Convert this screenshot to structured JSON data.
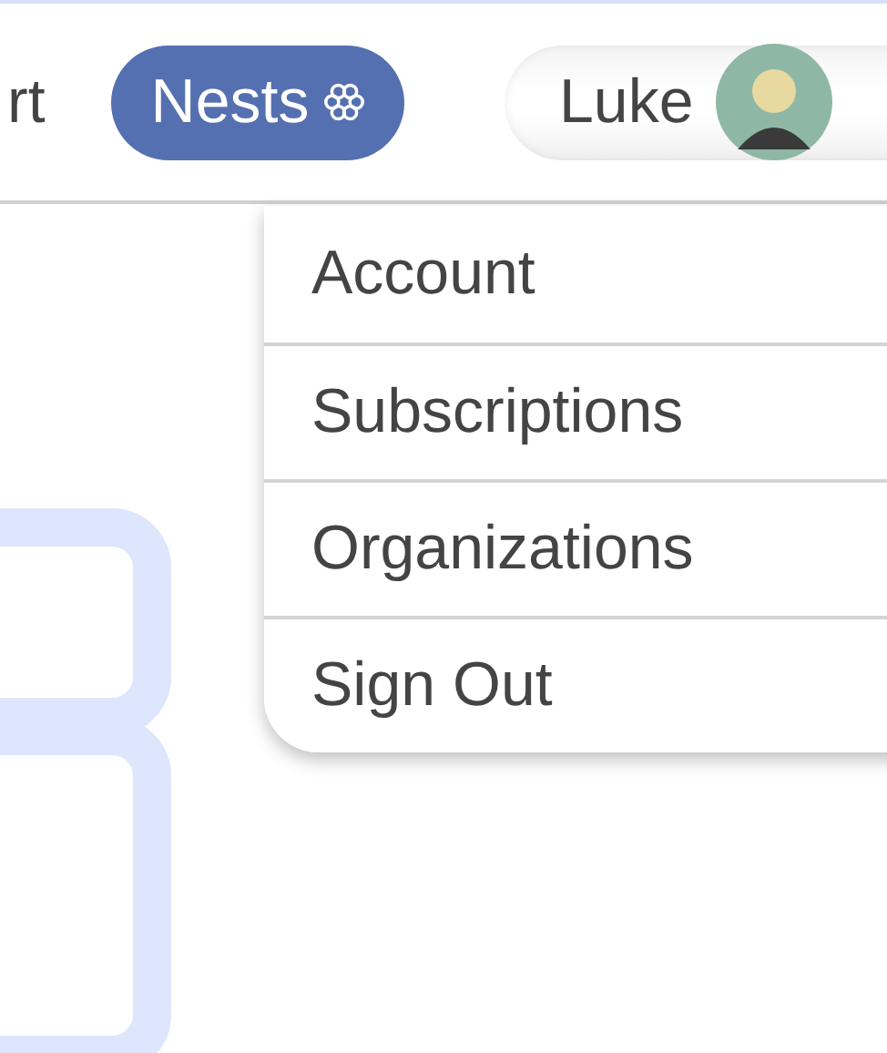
{
  "nav": [
    {
      "label": "rt",
      "selected": false
    },
    {
      "label": "Nests",
      "selected": true
    }
  ],
  "user": {
    "name": "Luke"
  },
  "menu": [
    {
      "label": "Account"
    },
    {
      "label": "Subscriptions"
    },
    {
      "label": "Organizations"
    },
    {
      "label": "Sign Out"
    }
  ]
}
